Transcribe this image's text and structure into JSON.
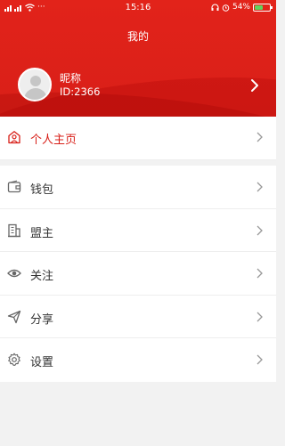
{
  "status_bar": {
    "signal_left": "▐▐",
    "more": "···",
    "time": "15:16",
    "battery_pct": "54%",
    "battery_level": 0.54
  },
  "header": {
    "title": "我的"
  },
  "profile": {
    "nickname": "昵称",
    "id": "ID:2366"
  },
  "homepage_item": {
    "label": "个人主页",
    "icon": "user-home-icon"
  },
  "menu": [
    {
      "label": "钱包",
      "icon": "wallet-icon"
    },
    {
      "label": "盟主",
      "icon": "building-icon"
    },
    {
      "label": "关注",
      "icon": "eye-icon"
    },
    {
      "label": "分享",
      "icon": "share-icon"
    },
    {
      "label": "设置",
      "icon": "settings-icon"
    }
  ],
  "colors": {
    "brand_red": "#d81f18",
    "icon_gray": "#666666",
    "arrow_gray": "#999999"
  }
}
